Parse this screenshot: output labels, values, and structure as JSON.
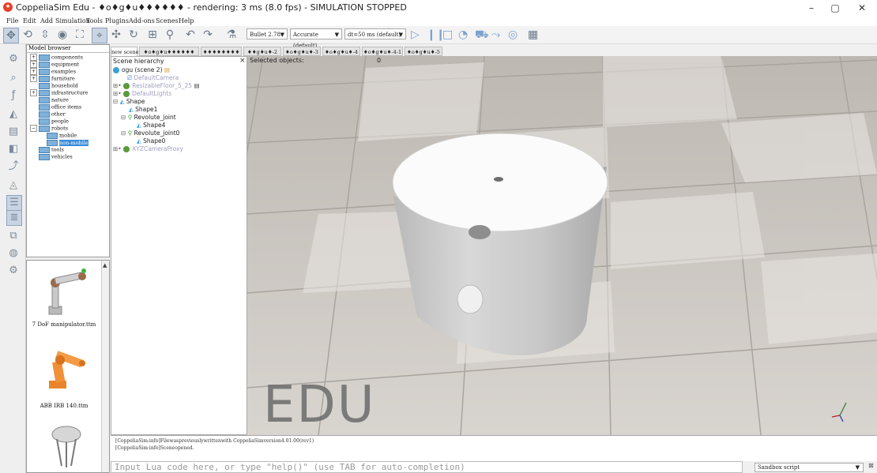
{
  "window": {
    "title": "CoppeliaSim Edu - \u0000o\u0000g\u0000u\u0000\u0000\u0000\u0000\u0000\u0000 - rendering: 3 ms (8.0 fps) - SIMULATION STOPPED",
    "title_display": "CoppeliaSim Edu - ♦o♦g♦u♦♦♦♦♦♦ - rendering: 3 ms (8.0 fps) - SIMULATION STOPPED",
    "minimize": "–",
    "maximize": "▢",
    "close": "✕"
  },
  "menu": [
    "File",
    "Edit",
    "Add",
    "Simulation",
    "Tools",
    "Plugins",
    "Add-ons",
    "Scenes",
    "Help"
  ],
  "toolbar": {
    "physics_engine": "Bullet 2.78",
    "accuracy": "Accurate (default)",
    "timestep": "dt=50 ms (default)"
  },
  "model_browser": {
    "title": "Model browser",
    "items": [
      {
        "label": "components",
        "expander": "+"
      },
      {
        "label": "equipment",
        "expander": "+"
      },
      {
        "label": "examples",
        "expander": "+"
      },
      {
        "label": "furniture",
        "expander": "+"
      },
      {
        "label": "household",
        "expander": ""
      },
      {
        "label": "infrastructure",
        "expander": "+"
      },
      {
        "label": "nature",
        "expander": ""
      },
      {
        "label": "office items",
        "expander": ""
      },
      {
        "label": "other",
        "expander": ""
      },
      {
        "label": "people",
        "expander": ""
      },
      {
        "label": "robots",
        "expander": "−"
      },
      {
        "label": "mobile",
        "expander": ""
      },
      {
        "label": "non-mobile",
        "expander": ""
      },
      {
        "label": "tools",
        "expander": ""
      },
      {
        "label": "vehicles",
        "expander": ""
      }
    ]
  },
  "model_thumbs": [
    {
      "label": "7 DoF manipulator.ttm"
    },
    {
      "label": "ABB IRB 140.ttm"
    }
  ],
  "scene_tabs": [
    "new scene",
    "♦o♦g♦u♦♦♦♦♦♦",
    "♦♦♦♦♦♦♦♦",
    "♦♦g♦u♦-2",
    "♦o♦g♦u♦-3",
    "♦o♦g♦u♦-4",
    "♦o♦g♦u♦-4-1",
    "♦o♦g♦u♦-5"
  ],
  "scene_hierarchy": {
    "title": "Scene hierarchy",
    "close": "×",
    "items": [
      {
        "label": "ogu (scene 2)",
        "dim": false
      },
      {
        "label": "DefaultCamera",
        "dim": true
      },
      {
        "label": "ResizableFloor_5_25",
        "dim": true
      },
      {
        "label": "DefaultLights",
        "dim": true
      },
      {
        "label": "Shape",
        "dim": false
      },
      {
        "label": "Shape1",
        "dim": false
      },
      {
        "label": "Revolute_joint",
        "dim": false
      },
      {
        "label": "Shape4",
        "dim": false
      },
      {
        "label": "Revolute_joint0",
        "dim": false
      },
      {
        "label": "Shape0",
        "dim": false
      },
      {
        "label": "XYZCameraProxy",
        "dim": true
      }
    ]
  },
  "viewport": {
    "selected_label": "Selected objects:",
    "selected_count": "0",
    "watermark": "EDU"
  },
  "console": {
    "lines": [
      "[CoppeliaSim:info]Filewaspreviouslywrittenwith CoppeliaSimversion4.01.00(rev1)",
      "[CoppeliaSim:info]Sceneopened."
    ],
    "input_placeholder": "Input Lua code here, or type \"help()\" (use TAB for auto-completion)",
    "script_target": "Sandbox script"
  }
}
